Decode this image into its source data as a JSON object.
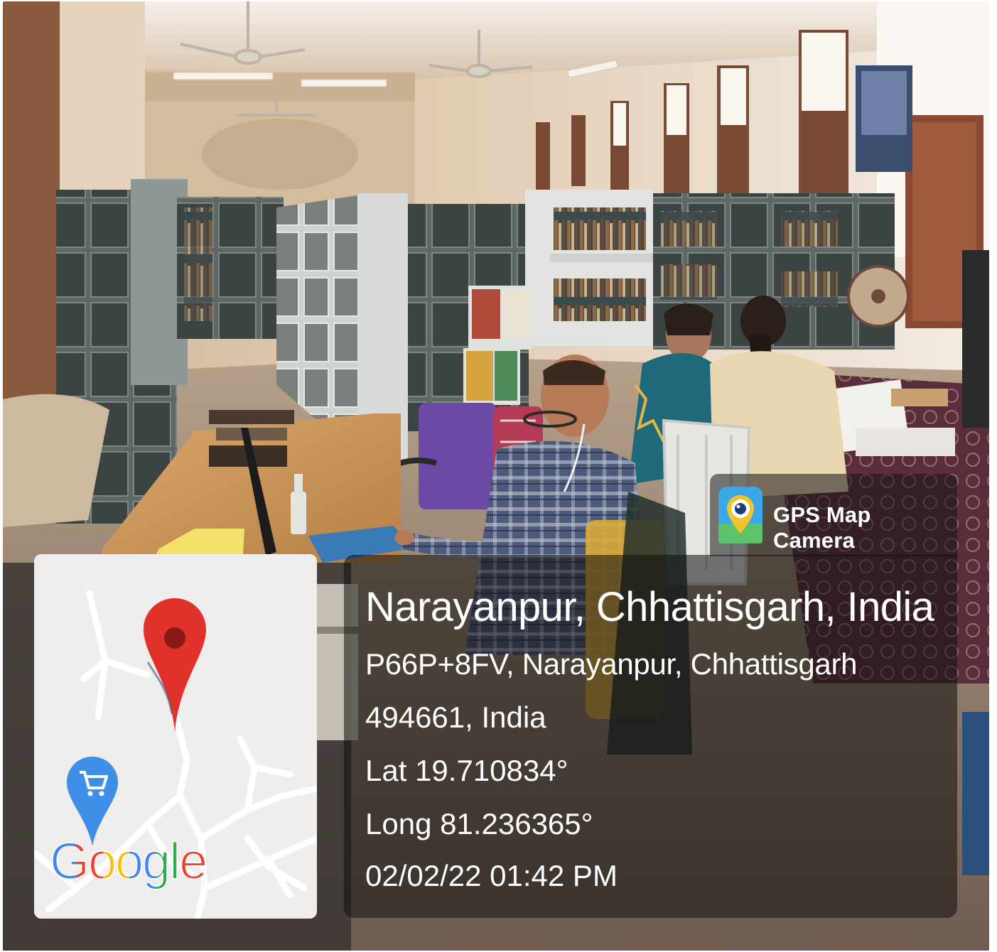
{
  "watermark": {
    "app_name": "GPS Map Camera",
    "location_title": "Narayanpur, Chhattisgarh, India",
    "address_line1": "P66P+8FV, Narayanpur, Chhattisgarh",
    "address_line2": "494661, India",
    "latitude": "Lat 19.710834°",
    "longitude": "Long 81.236365°",
    "datetime": "02/02/22 01:42 PM"
  },
  "map": {
    "logo": "Google",
    "icons": [
      "map-pin-icon",
      "shopping-cart-pin-icon"
    ]
  },
  "colors": {
    "overlay": "#141414",
    "pin_red": "#e0322b",
    "pin_dark": "#8a1a15",
    "cart_blue": "#3f8ee8",
    "google_blue": "#4285F4",
    "google_red": "#EA4335",
    "google_yellow": "#FBBC05",
    "google_green": "#34A853"
  }
}
